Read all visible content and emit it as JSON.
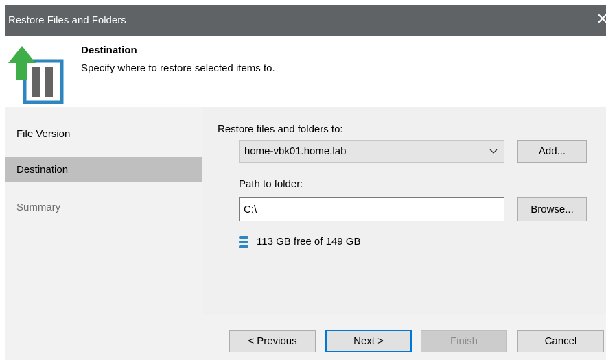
{
  "window": {
    "title": "Restore Files and Folders",
    "close_glyph": "✕"
  },
  "header": {
    "icon": "restore-arrow-icon",
    "title": "Destination",
    "subtitle": "Specify where to restore selected items to."
  },
  "nav": {
    "items": [
      {
        "label": "File Version",
        "state": "normal"
      },
      {
        "label": "Destination",
        "state": "active"
      },
      {
        "label": "Summary",
        "state": "disabled"
      }
    ]
  },
  "content": {
    "restore_to_label": "Restore files and folders to:",
    "server_selected": "home-vbk01.home.lab",
    "add_button": "Add...",
    "path_label": "Path to folder:",
    "path_value": "C:\\",
    "browse_button": "Browse...",
    "disk_icon": "database-icon",
    "free_space": "113 GB free of 149 GB"
  },
  "footer": {
    "previous": "< Previous",
    "next": "Next >",
    "finish": "Finish",
    "cancel": "Cancel"
  },
  "colors": {
    "titlebar": "#5f6366",
    "accent_blue": "#0078d7",
    "arrow_green": "#3fae49",
    "nav_active": "#bfbfbf"
  }
}
